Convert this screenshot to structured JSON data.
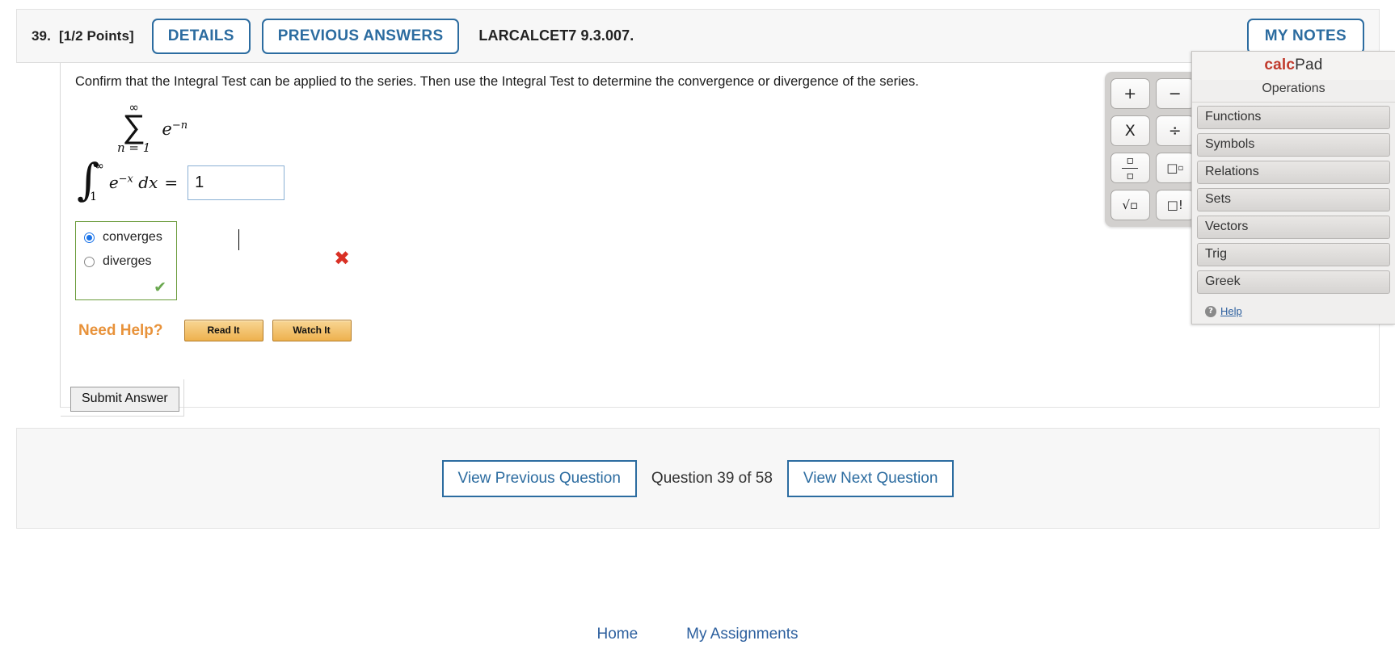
{
  "header": {
    "question_number": "39.",
    "points": "[1/2 Points]",
    "details_label": "DETAILS",
    "previous_answers_label": "PREVIOUS ANSWERS",
    "problem_code": "LARCALCET7 9.3.007.",
    "my_notes_label": "MY NOTES"
  },
  "question": {
    "prompt": "Confirm that the Integral Test can be applied to the series. Then use the Integral Test to determine the convergence or divergence of the series.",
    "series": {
      "upper_limit": "∞",
      "sigma": "∑",
      "lower_limit": "n = 1",
      "term_base": "e",
      "term_exponent": "−n"
    },
    "integral": {
      "glyph": "∫",
      "upper_limit": "∞",
      "lower_limit": "1",
      "integrand": "e",
      "integrand_exponent": "−x",
      "differential": "dx",
      "equals": "=",
      "answer_value": "1",
      "grade_mark": "✖"
    },
    "choices": [
      {
        "label": "converges",
        "selected": true
      },
      {
        "label": "diverges",
        "selected": false
      }
    ],
    "choices_grade_mark": "✔",
    "need_help_label": "Need Help?",
    "read_it_label": "Read It",
    "watch_it_label": "Watch It",
    "submit_label": "Submit Answer"
  },
  "calcpad": {
    "brand_first": "calc",
    "brand_second": "Pad",
    "subtitle": "Operations",
    "categories": [
      "Functions",
      "Symbols",
      "Relations",
      "Sets",
      "Vectors",
      "Trig",
      "Greek"
    ],
    "help_label": "Help",
    "help_icon_glyph": "?",
    "keys": [
      {
        "name": "plus",
        "glyph": "+"
      },
      {
        "name": "minus",
        "glyph": "−"
      },
      {
        "name": "multiply",
        "glyph": "X"
      },
      {
        "name": "divide",
        "glyph": "÷"
      },
      {
        "name": "fraction",
        "glyph": "□/□"
      },
      {
        "name": "exponent",
        "glyph": "□□"
      },
      {
        "name": "sqrt",
        "glyph": "√□"
      },
      {
        "name": "factorial",
        "glyph": "□!"
      }
    ]
  },
  "navigation": {
    "previous_label": "View Previous Question",
    "counter": "Question 39 of 58",
    "next_label": "View Next Question"
  },
  "footer": {
    "links": [
      "Home",
      "My Assignments"
    ]
  },
  "colors": {
    "accent_blue": "#2c6ca0",
    "correct_green": "#6aa84f",
    "incorrect_red": "#d93025",
    "help_orange": "#e8923a",
    "calcpad_red": "#c0392b"
  }
}
